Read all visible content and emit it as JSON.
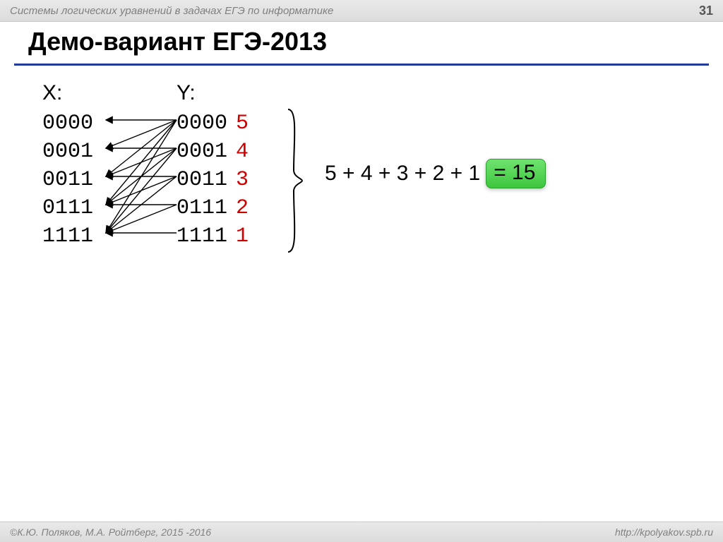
{
  "header": {
    "subject": "Системы логических уравнений в задачах ЕГЭ по информатике",
    "page": "31"
  },
  "title": "Демо-вариант ЕГЭ-2013",
  "columns": {
    "x": {
      "label": "X:",
      "values": [
        "0000",
        "0001",
        "0011",
        "0111",
        "1111"
      ]
    },
    "y": {
      "label": "Y:",
      "values": [
        "0000",
        "0001",
        "0011",
        "0111",
        "1111"
      ],
      "counts": [
        "5",
        "4",
        "3",
        "2",
        "1"
      ]
    }
  },
  "sum_expr": "5 + 4 + 3 + 2 + 1",
  "answer": "= 15",
  "footer": {
    "left": "©К.Ю. Поляков, М.А. Ройтберг, 2015 -2016",
    "right": "http://kpolyakov.spb.ru"
  }
}
